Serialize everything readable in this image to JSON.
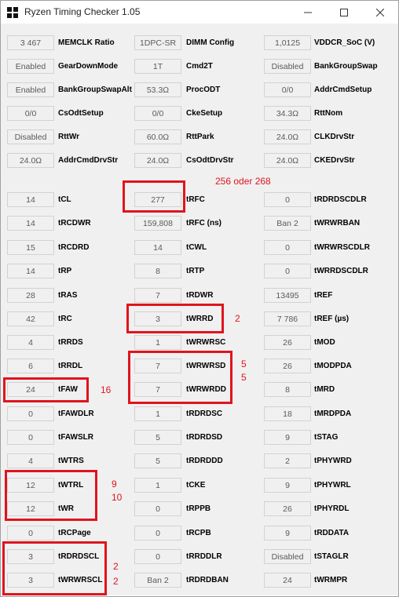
{
  "window": {
    "title": "Ryzen Timing Checker 1.05",
    "min_icon": "minimize-icon",
    "max_icon": "maximize-icon",
    "close_icon": "close-icon"
  },
  "col1": [
    {
      "value": "3 467",
      "label": "MEMCLK Ratio"
    },
    {
      "value": "Enabled",
      "label": "GearDownMode"
    },
    {
      "value": "Enabled",
      "label": "BankGroupSwapAlt"
    },
    {
      "value": "0/0",
      "label": "CsOdtSetup"
    },
    {
      "value": "Disabled",
      "label": "RttWr"
    },
    {
      "value": "24.0Ω",
      "label": "AddrCmdDrvStr"
    },
    {
      "value": "14",
      "label": "tCL"
    },
    {
      "value": "14",
      "label": "tRCDWR"
    },
    {
      "value": "15",
      "label": "tRCDRD"
    },
    {
      "value": "14",
      "label": "tRP"
    },
    {
      "value": "28",
      "label": "tRAS"
    },
    {
      "value": "42",
      "label": "tRC"
    },
    {
      "value": "4",
      "label": "tRRDS"
    },
    {
      "value": "6",
      "label": "tRRDL"
    },
    {
      "value": "24",
      "label": "tFAW"
    },
    {
      "value": "0",
      "label": "tFAWDLR"
    },
    {
      "value": "0",
      "label": "tFAWSLR"
    },
    {
      "value": "4",
      "label": "tWTRS"
    },
    {
      "value": "12",
      "label": "tWTRL"
    },
    {
      "value": "12",
      "label": "tWR"
    },
    {
      "value": "0",
      "label": "tRCPage"
    },
    {
      "value": "3",
      "label": "tRDRDSCL"
    },
    {
      "value": "3",
      "label": "tWRWRSCL"
    }
  ],
  "col2": [
    {
      "value": "1DPC-SR",
      "label": "DIMM Config"
    },
    {
      "value": "1T",
      "label": "Cmd2T"
    },
    {
      "value": "53.3Ω",
      "label": "ProcODT"
    },
    {
      "value": "0/0",
      "label": "CkeSetup"
    },
    {
      "value": "60.0Ω",
      "label": "RttPark"
    },
    {
      "value": "24.0Ω",
      "label": "CsOdtDrvStr"
    },
    {
      "value": "277",
      "label": "tRFC"
    },
    {
      "value": "159,808",
      "label": "tRFC (ns)"
    },
    {
      "value": "14",
      "label": "tCWL"
    },
    {
      "value": "8",
      "label": "tRTP"
    },
    {
      "value": "7",
      "label": "tRDWR"
    },
    {
      "value": "3",
      "label": "tWRRD"
    },
    {
      "value": "1",
      "label": "tWRWRSC"
    },
    {
      "value": "7",
      "label": "tWRWRSD"
    },
    {
      "value": "7",
      "label": "tWRWRDD"
    },
    {
      "value": "1",
      "label": "tRDRDSC"
    },
    {
      "value": "5",
      "label": "tRDRDSD"
    },
    {
      "value": "5",
      "label": "tRDRDDD"
    },
    {
      "value": "1",
      "label": "tCKE"
    },
    {
      "value": "0",
      "label": "tRPPB"
    },
    {
      "value": "0",
      "label": "tRCPB"
    },
    {
      "value": "0",
      "label": "tRRDDLR"
    },
    {
      "value": "Ban 2",
      "label": "tRDRDBAN"
    }
  ],
  "col3": [
    {
      "value": "1,0125",
      "label": "VDDCR_SoC (V)"
    },
    {
      "value": "Disabled",
      "label": "BankGroupSwap"
    },
    {
      "value": "0/0",
      "label": "AddrCmdSetup"
    },
    {
      "value": "34.3Ω",
      "label": "RttNom"
    },
    {
      "value": "24.0Ω",
      "label": "CLKDrvStr"
    },
    {
      "value": "24.0Ω",
      "label": "CKEDrvStr"
    },
    {
      "value": "0",
      "label": "tRDRDSCDLR"
    },
    {
      "value": "Ban 2",
      "label": "tWRWRBAN"
    },
    {
      "value": "0",
      "label": "tWRWRSCDLR"
    },
    {
      "value": "0",
      "label": "tWRRDSCDLR"
    },
    {
      "value": "13495",
      "label": "tREF"
    },
    {
      "value": "7 786",
      "label": "tREF (µs)"
    },
    {
      "value": "26",
      "label": "tMOD"
    },
    {
      "value": "26",
      "label": "tMODPDA"
    },
    {
      "value": "8",
      "label": "tMRD"
    },
    {
      "value": "18",
      "label": "tMRDPDA"
    },
    {
      "value": "9",
      "label": "tSTAG"
    },
    {
      "value": "2",
      "label": "tPHYWRD"
    },
    {
      "value": "9",
      "label": "tPHYWRL"
    },
    {
      "value": "26",
      "label": "tPHYRDL"
    },
    {
      "value": "9",
      "label": "tRDDATA"
    },
    {
      "value": "Disabled",
      "label": "tSTAGLR"
    },
    {
      "value": "24",
      "label": "tWRMPR"
    }
  ],
  "annotations": {
    "trfc": "256 oder 268",
    "twrrd": "2",
    "twrwrsd": "5",
    "twrwrdd": "5",
    "tfaw": "16",
    "twtrl": "9",
    "twr": "10",
    "trdrdscl": "2",
    "twrwrscl": "2"
  }
}
